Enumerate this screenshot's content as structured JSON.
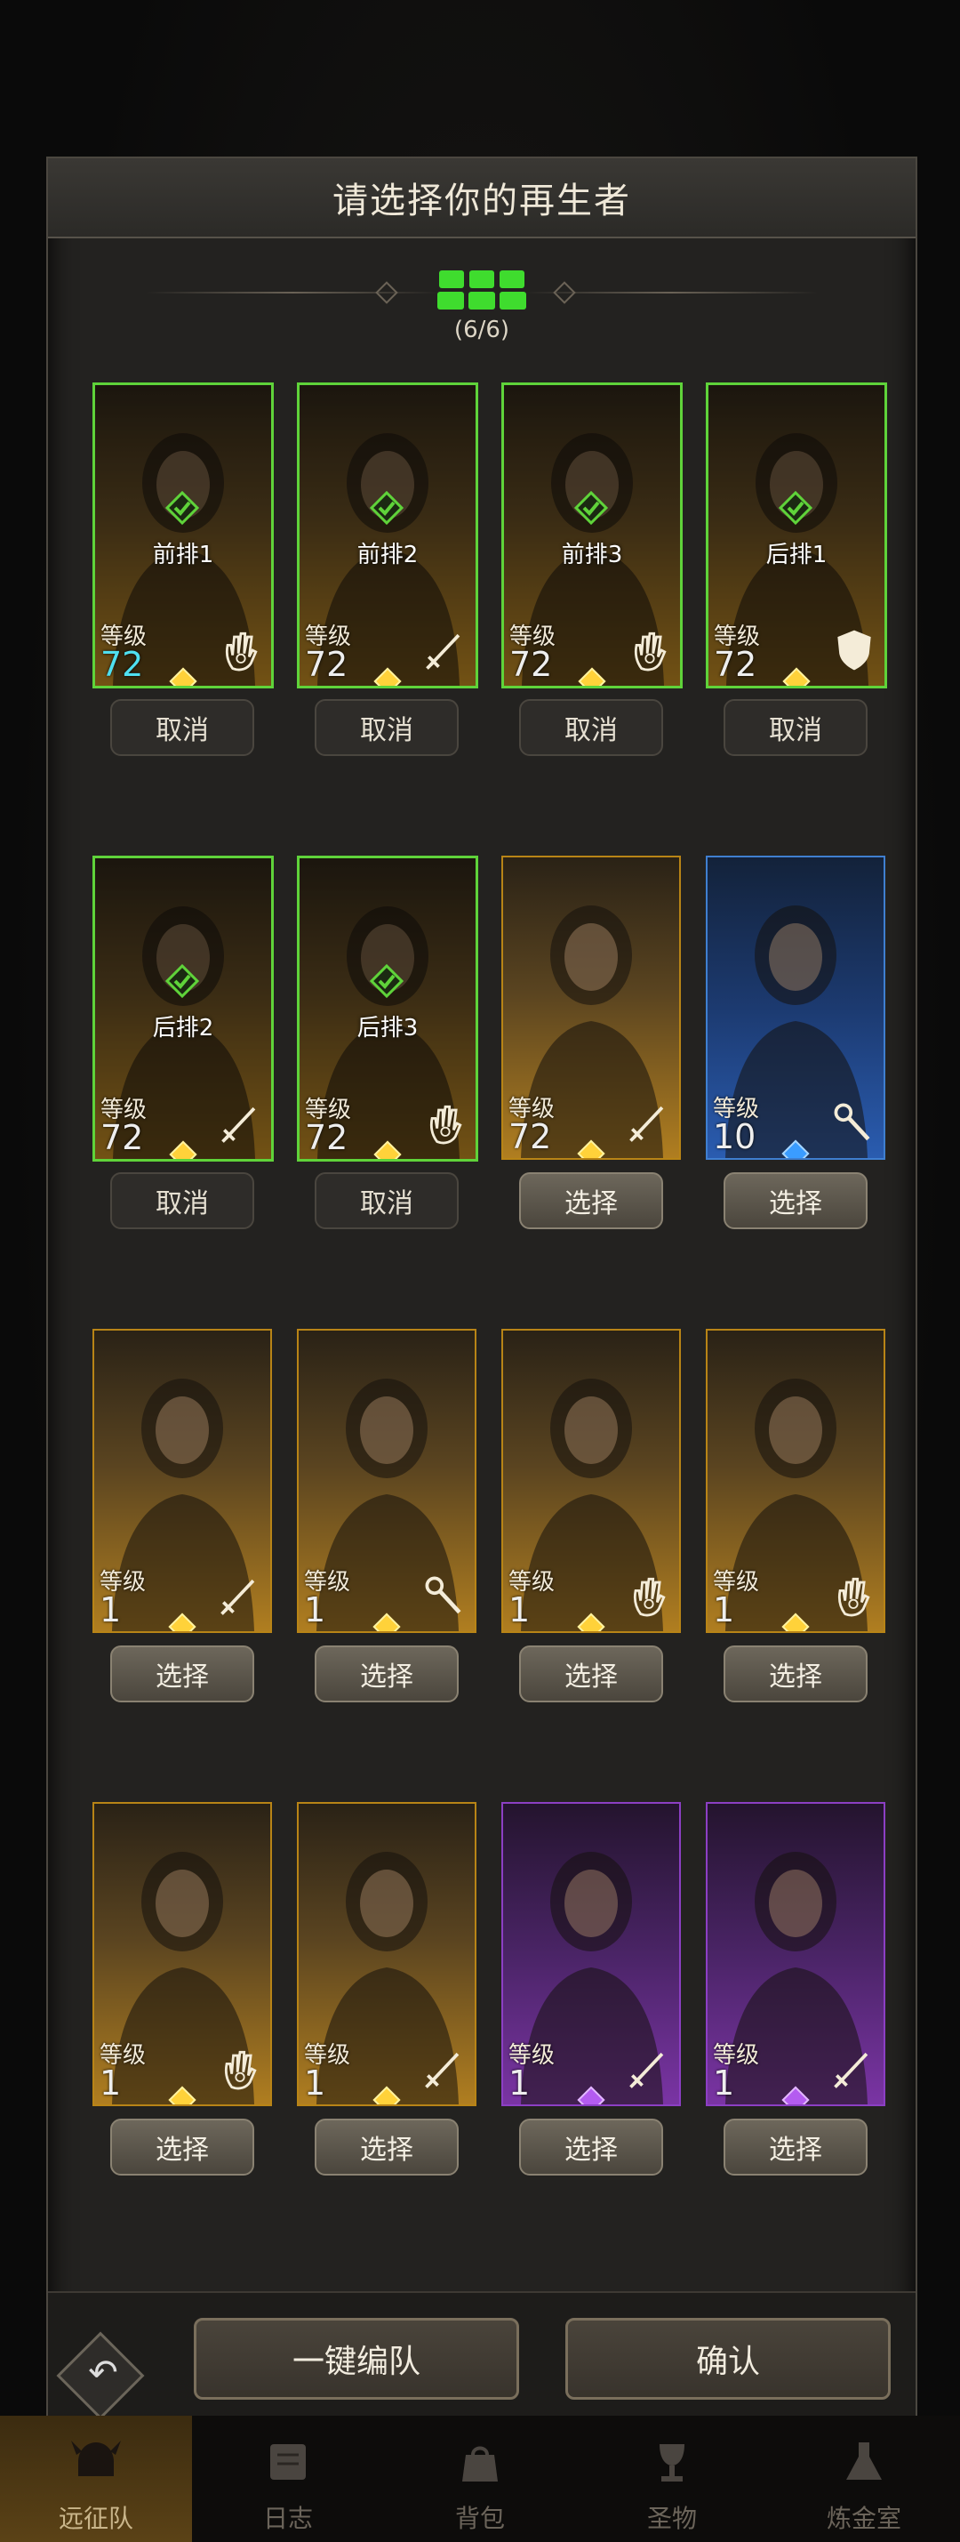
{
  "dialog": {
    "title": "请选择你的再生者",
    "formation_count": "(6/6)"
  },
  "heroes": [
    {
      "slot": "前排1",
      "level_label": "等级",
      "level": "72",
      "cls": "hand",
      "rarity": "gold",
      "selected": true,
      "btn": "取消",
      "cyan": true
    },
    {
      "slot": "前排2",
      "level_label": "等级",
      "level": "72",
      "cls": "sword",
      "rarity": "gold",
      "selected": true,
      "btn": "取消"
    },
    {
      "slot": "前排3",
      "level_label": "等级",
      "level": "72",
      "cls": "hand",
      "rarity": "gold",
      "selected": true,
      "btn": "取消"
    },
    {
      "slot": "后排1",
      "level_label": "等级",
      "level": "72",
      "cls": "shield",
      "rarity": "gold",
      "selected": true,
      "btn": "取消"
    },
    {
      "slot": "后排2",
      "level_label": "等级",
      "level": "72",
      "cls": "sword",
      "rarity": "gold",
      "selected": true,
      "btn": "取消"
    },
    {
      "slot": "后排3",
      "level_label": "等级",
      "level": "72",
      "cls": "hand",
      "rarity": "gold",
      "selected": true,
      "btn": "取消"
    },
    {
      "slot": "",
      "level_label": "等级",
      "level": "72",
      "cls": "sword",
      "rarity": "gold",
      "selected": false,
      "btn": "选择"
    },
    {
      "slot": "",
      "level_label": "等级",
      "level": "10",
      "cls": "staff",
      "rarity": "blue",
      "selected": false,
      "btn": "选择"
    },
    {
      "slot": "",
      "level_label": "等级",
      "level": "1",
      "cls": "sword",
      "rarity": "gold",
      "selected": false,
      "btn": "选择"
    },
    {
      "slot": "",
      "level_label": "等级",
      "level": "1",
      "cls": "staff",
      "rarity": "gold",
      "selected": false,
      "btn": "选择"
    },
    {
      "slot": "",
      "level_label": "等级",
      "level": "1",
      "cls": "hand",
      "rarity": "gold",
      "selected": false,
      "btn": "选择"
    },
    {
      "slot": "",
      "level_label": "等级",
      "level": "1",
      "cls": "hand",
      "rarity": "gold",
      "selected": false,
      "btn": "选择"
    },
    {
      "slot": "",
      "level_label": "等级",
      "level": "1",
      "cls": "hand",
      "rarity": "gold",
      "selected": false,
      "btn": "选择"
    },
    {
      "slot": "",
      "level_label": "等级",
      "level": "1",
      "cls": "sword",
      "rarity": "gold",
      "selected": false,
      "btn": "选择"
    },
    {
      "slot": "",
      "level_label": "等级",
      "level": "1",
      "cls": "sword",
      "rarity": "purple",
      "selected": false,
      "btn": "选择"
    },
    {
      "slot": "",
      "level_label": "等级",
      "level": "1",
      "cls": "sword",
      "rarity": "purple",
      "selected": false,
      "btn": "选择"
    }
  ],
  "footer": {
    "auto_team_label": "一键编队",
    "confirm_label": "确认",
    "back_icon": "undo-arrow-icon"
  },
  "nav": [
    {
      "label": "远征队",
      "icon": "horned-helmet-icon",
      "active": true
    },
    {
      "label": "日志",
      "icon": "scroll-icon",
      "active": false
    },
    {
      "label": "背包",
      "icon": "bag-icon",
      "active": false
    },
    {
      "label": "圣物",
      "icon": "chalice-icon",
      "active": false
    },
    {
      "label": "炼金室",
      "icon": "alchemy-icon",
      "active": false
    }
  ],
  "colors": {
    "selected_border": "#5fd33a",
    "gold": "#b88416",
    "blue": "#3f7fd0",
    "purple": "#8c3fc4",
    "level_cyan": "#4fe0f0"
  }
}
